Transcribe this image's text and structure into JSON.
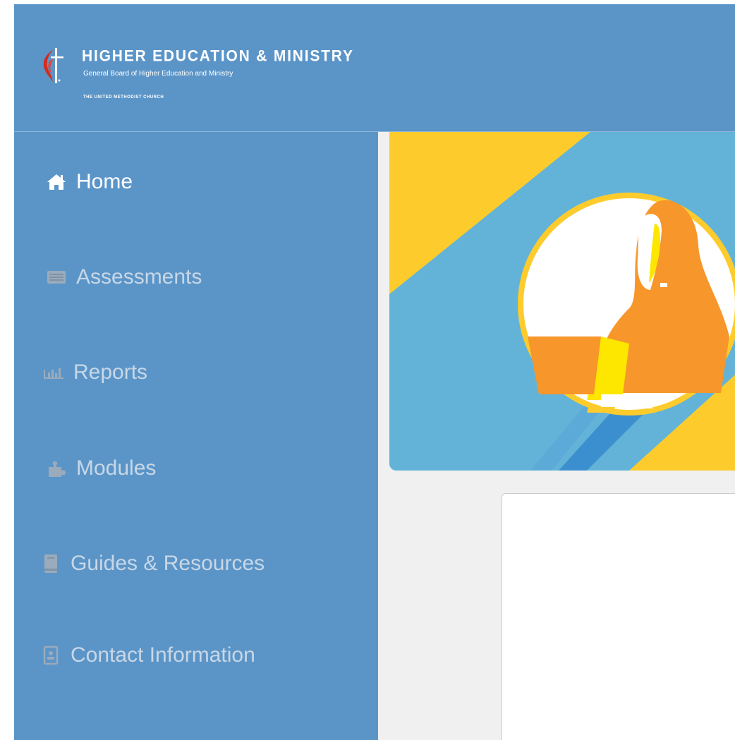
{
  "brand": {
    "title": "HIGHER EDUCATION & MINISTRY",
    "subtitle": "General Board of Higher Education and Ministry",
    "church": "THE UNITED METHODIST CHURCH"
  },
  "sidebar": {
    "items": [
      {
        "label": "Home",
        "icon": "home-icon",
        "active": true
      },
      {
        "label": "Assessments",
        "icon": "list-icon",
        "active": false
      },
      {
        "label": "Reports",
        "icon": "bar-chart-icon",
        "active": false
      },
      {
        "label": "Modules",
        "icon": "puzzle-icon",
        "active": false
      },
      {
        "label": "Guides & Resources",
        "icon": "book-icon",
        "active": false
      },
      {
        "label": "Contact Information",
        "icon": "contact-icon",
        "active": false
      }
    ]
  },
  "colors": {
    "header": "#5b95c8",
    "sidebar": "#5b95c8",
    "active_text": "#ffffff",
    "inactive_text": "#c8d7e6",
    "hero_blue": "#63b3d8",
    "hero_yellow": "#fdcc2c",
    "figure_orange": "#f7962a"
  }
}
